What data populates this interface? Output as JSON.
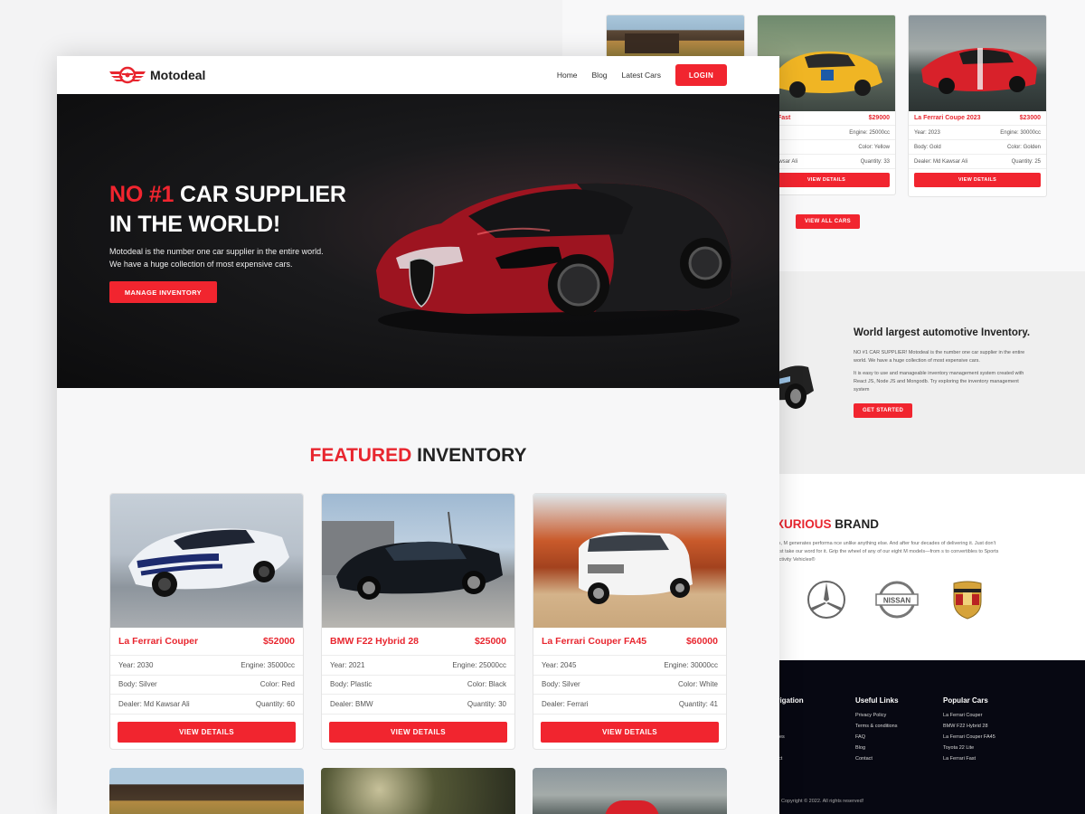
{
  "brand": {
    "name": "Motodeal"
  },
  "nav": {
    "items": [
      "Home",
      "Blog",
      "Latest Cars"
    ],
    "login": "LOGIN"
  },
  "hero": {
    "title_red": "NO #1",
    "title_rest": "CAR SUPPLIER",
    "title_line2": "IN THE WORLD!",
    "line1": "Motodeal is the number one car supplier in the entire world.",
    "line2": "We have a huge collection of most expensive cars.",
    "cta": "MANAGE INVENTORY"
  },
  "featured": {
    "title_red": "FEATURED",
    "title_rest": "INVENTORY"
  },
  "cards": [
    {
      "name": "La Ferrari Couper",
      "price": "$52000",
      "year": "Year: 2030",
      "engine": "Engine: 35000cc",
      "body": "Body: Silver",
      "color": "Color: Red",
      "dealer": "Dealer: Md Kawsar Ali",
      "quantity": "Quantity: 60",
      "button": "VIEW DETAILS"
    },
    {
      "name": "BMW F22 Hybrid 28",
      "price": "$25000",
      "year": "Year: 2021",
      "engine": "Engine: 25000cc",
      "body": "Body: Plastic",
      "color": "Color: Black",
      "dealer": "Dealer: BMW",
      "quantity": "Quantity: 30",
      "button": "VIEW DETAILS"
    },
    {
      "name": "La Ferrari Couper FA45",
      "price": "$60000",
      "year": "Year: 2045",
      "engine": "Engine: 30000cc",
      "body": "Body: Silver",
      "color": "Color: White",
      "dealer": "Dealer: Ferrari",
      "quantity": "Quantity: 41",
      "button": "VIEW DETAILS"
    }
  ],
  "back_cards": [
    {
      "name": "rrari Fast",
      "price": "$29000",
      "year": "022",
      "engine": "Engine: 25000cc",
      "body": "ilver",
      "color": "Color: Yellow",
      "dealer": "Md Kawsar Ali",
      "quantity": "Quantity: 33",
      "button": "VIEW DETAILS"
    },
    {
      "name": "La Ferrari Coupe 2023",
      "price": "$23000",
      "year": "Year: 2023",
      "engine": "Engine: 30000cc",
      "body": "Body: Gold",
      "color": "Color: Golden",
      "dealer": "Dealer: Md Kawsar Ali",
      "quantity": "Quantity: 25",
      "button": "VIEW DETAILS"
    }
  ],
  "view_all": "VIEW ALL CARS",
  "about": {
    "title": "World largest automotive Inventory.",
    "p1": "NO #1 CAR SUPPLIER! Motodeal is the number one car supplier in the entire world. We have a huge collection of most expensive cars.",
    "p2": "It is easy to use and manageable inventory management system created with React JS, Node JS and Mongodb. Try exploring the inventory management system",
    "button": "GET STARTED"
  },
  "luxury": {
    "title_red": "XURIOUS",
    "title_rest": "BRAND",
    "text": "ck, M generates performa nce unlike anything else. And after four decades of delivering it. Just don't just take our word for it. Grip the wheel of any of our eight M models—from s to convertibles to Sports Activity Vehicles®"
  },
  "footer": {
    "nav_title": "vigation",
    "nav_items": [
      "e",
      "t",
      "ices",
      "act"
    ],
    "useful_title": "Useful Links",
    "useful": [
      "Privacy Policy",
      "Terms & conditions",
      "FAQ",
      "Blog",
      "Contact"
    ],
    "popular_title": "Popular Cars",
    "popular": [
      "La Ferrari Couper",
      "BMW F22 Hybrid 28",
      "La Ferrari Couper FA45",
      "Toyota 22 Lite",
      "La Ferrari Fast"
    ],
    "copyright": "Copyright © 2022. All rights reserved!"
  },
  "colors": {
    "accent": "#f1252f",
    "dark": "#0c0c0d",
    "footer": "#070812"
  }
}
